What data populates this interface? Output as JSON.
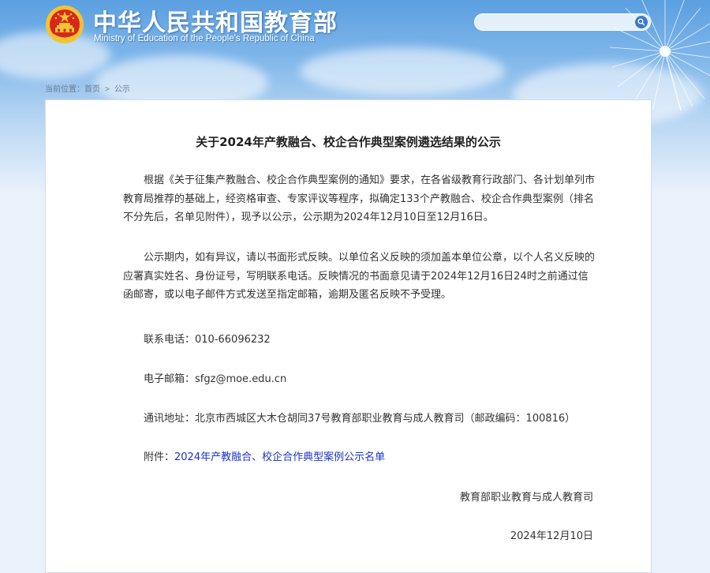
{
  "header": {
    "title_cn": "中华人民共和国教育部",
    "title_en": "Ministry of Education of the People's Republic of China",
    "search_placeholder": ""
  },
  "breadcrumb": {
    "prefix": "当前位置：",
    "home": "首页",
    "separator": ">",
    "current": "公示"
  },
  "article": {
    "title": "关于2024年产教融合、校企合作典型案例遴选结果的公示",
    "paragraphs": [
      "根据《关于征集产教融合、校企合作典型案例的通知》要求，在各省级教育行政部门、各计划单列市教育局推荐的基础上，经资格审查、专家评议等程序，拟确定133个产教融合、校企合作典型案例（排名不分先后，名单见附件），现予以公示，公示期为2024年12月10日至12月16日。",
      "公示期内，如有异议，请以书面形式反映。以单位名义反映的须加盖本单位公章，以个人名义反映的应署真实姓名、身份证号，写明联系电话。反映情况的书面意见请于2024年12月16日24时之前通过信函邮寄，或以电子邮件方式发送至指定邮箱，逾期及匿名反映不予受理。"
    ],
    "contact": {
      "phone_label": "联系电话：",
      "phone": "010-66096232",
      "email_label": "电子邮箱：",
      "email": "sfgz@moe.edu.cn",
      "address_label": "通讯地址：",
      "address": "北京市西城区大木仓胡同37号教育部职业教育与成人教育司（邮政编码：100816）"
    },
    "attachment": {
      "label": "附件：",
      "link_text": "2024年产教融合、校企合作典型案例公示名单"
    },
    "signature": "教育部职业教育与成人教育司",
    "date": "2024年12月10日"
  },
  "colors": {
    "link": "#1a33c8",
    "sky_top": "#5b9fe0",
    "emblem_red": "#d8261d",
    "emblem_gold": "#f3c431"
  },
  "icons": [
    "national-emblem-icon",
    "search-icon",
    "dandelion-decoration"
  ]
}
